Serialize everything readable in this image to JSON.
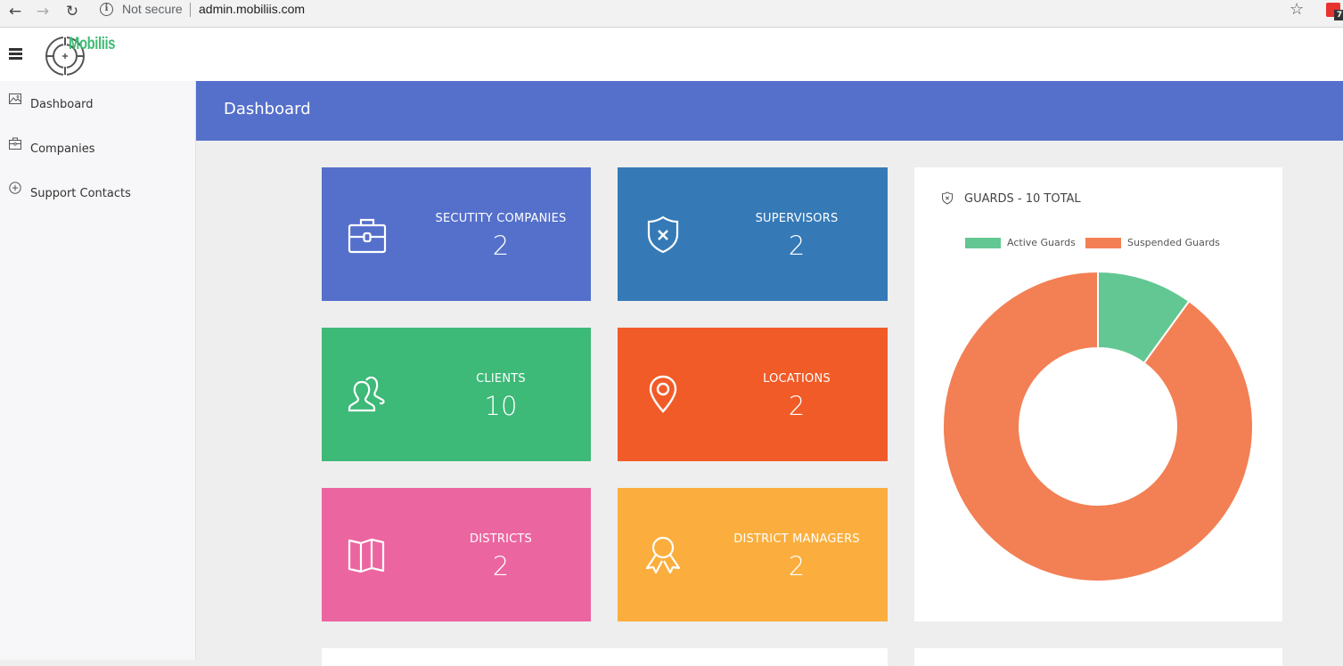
{
  "browser": {
    "back_icon": "←",
    "forward_icon": "→",
    "reload_icon": "↻",
    "security_label": "Not secure",
    "url": "admin.mobiliis.com",
    "star_icon": "☆",
    "extension_badge": "7"
  },
  "header": {
    "logo_text": "Mobiliis"
  },
  "sidebar": {
    "items": [
      {
        "label": "Dashboard",
        "icon": "image-icon"
      },
      {
        "label": "Companies",
        "icon": "briefcase-icon"
      },
      {
        "label": "Support Contacts",
        "icon": "plus-circle-icon"
      }
    ]
  },
  "page": {
    "title": "Dashboard"
  },
  "tiles": [
    {
      "label": "SECUTITY COMPANIES",
      "value": "2",
      "icon": "briefcase-icon",
      "color": "#5570cb"
    },
    {
      "label": "SUPERVISORS",
      "value": "2",
      "icon": "shield-x-icon",
      "color": "#357ab7"
    },
    {
      "label": "CLIENTS",
      "value": "10",
      "icon": "users-icon",
      "color": "#3db978"
    },
    {
      "label": "LOCATIONS",
      "value": "2",
      "icon": "map-pin-icon",
      "color": "#f15b28"
    },
    {
      "label": "DISTRICTS",
      "value": "2",
      "icon": "map-icon",
      "color": "#eb65a0"
    },
    {
      "label": "DISTRICT MANAGERS",
      "value": "2",
      "icon": "award-icon",
      "color": "#fbae3d"
    }
  ],
  "guards": {
    "title": "GUARDS - 10 TOTAL",
    "icon": "shield-x-icon"
  },
  "chart_data": {
    "type": "pie",
    "variant": "doughnut",
    "title": "GUARDS - 10 TOTAL",
    "categories": [
      "Active Guards",
      "Suspended Guards"
    ],
    "values": [
      1,
      9
    ],
    "colors": [
      "#63c793",
      "#f37f54"
    ],
    "legend": "top"
  }
}
